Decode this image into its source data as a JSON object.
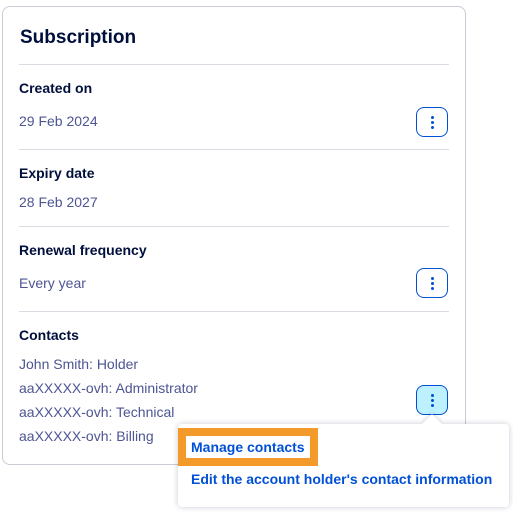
{
  "subscription": {
    "title": "Subscription",
    "created": {
      "label": "Created on",
      "value": "29 Feb 2024"
    },
    "expiry": {
      "label": "Expiry date",
      "value": "28 Feb 2027"
    },
    "renewal": {
      "label": "Renewal frequency",
      "value": "Every year"
    },
    "contacts": {
      "label": "Contacts",
      "items": [
        "John Smith: Holder",
        "aaXXXXX-ovh: Administrator",
        "aaXXXXX-ovh: Technical",
        "aaXXXXX-ovh: Billing"
      ]
    }
  },
  "menu": {
    "items": [
      "Manage contacts",
      "Edit the account holder's contact information"
    ]
  },
  "colors": {
    "accent": "#0050d7",
    "heading": "#000e3c",
    "text": "#4d5592",
    "highlight": "#f39a2b",
    "active_button": "#bef1ff"
  },
  "icons": {
    "action_button": "kebab-menu-icon"
  }
}
